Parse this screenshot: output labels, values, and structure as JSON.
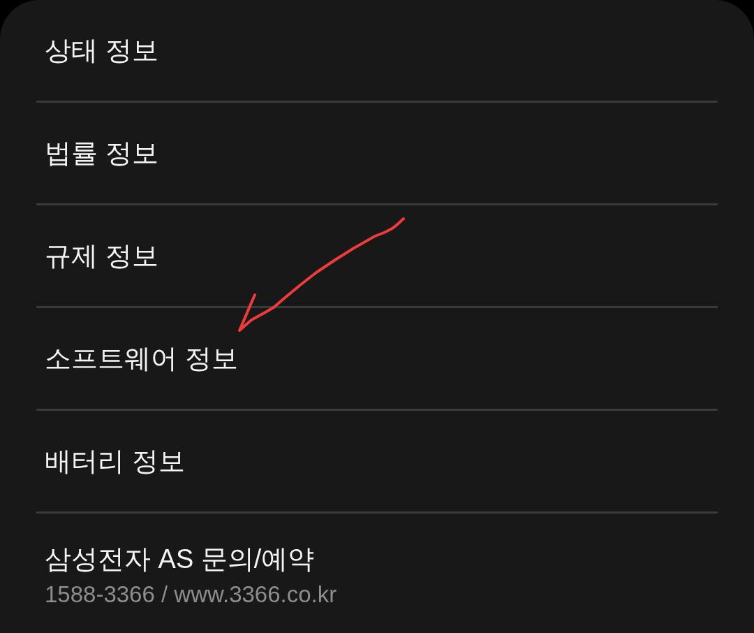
{
  "items": [
    {
      "title": "상태 정보"
    },
    {
      "title": "법률 정보"
    },
    {
      "title": "규제 정보"
    },
    {
      "title": "소프트웨어 정보"
    },
    {
      "title": "배터리 정보"
    },
    {
      "title": "삼성전자 AS 문의/예약",
      "subtitle": "1588-3366 / www.3366.co.kr"
    }
  ]
}
